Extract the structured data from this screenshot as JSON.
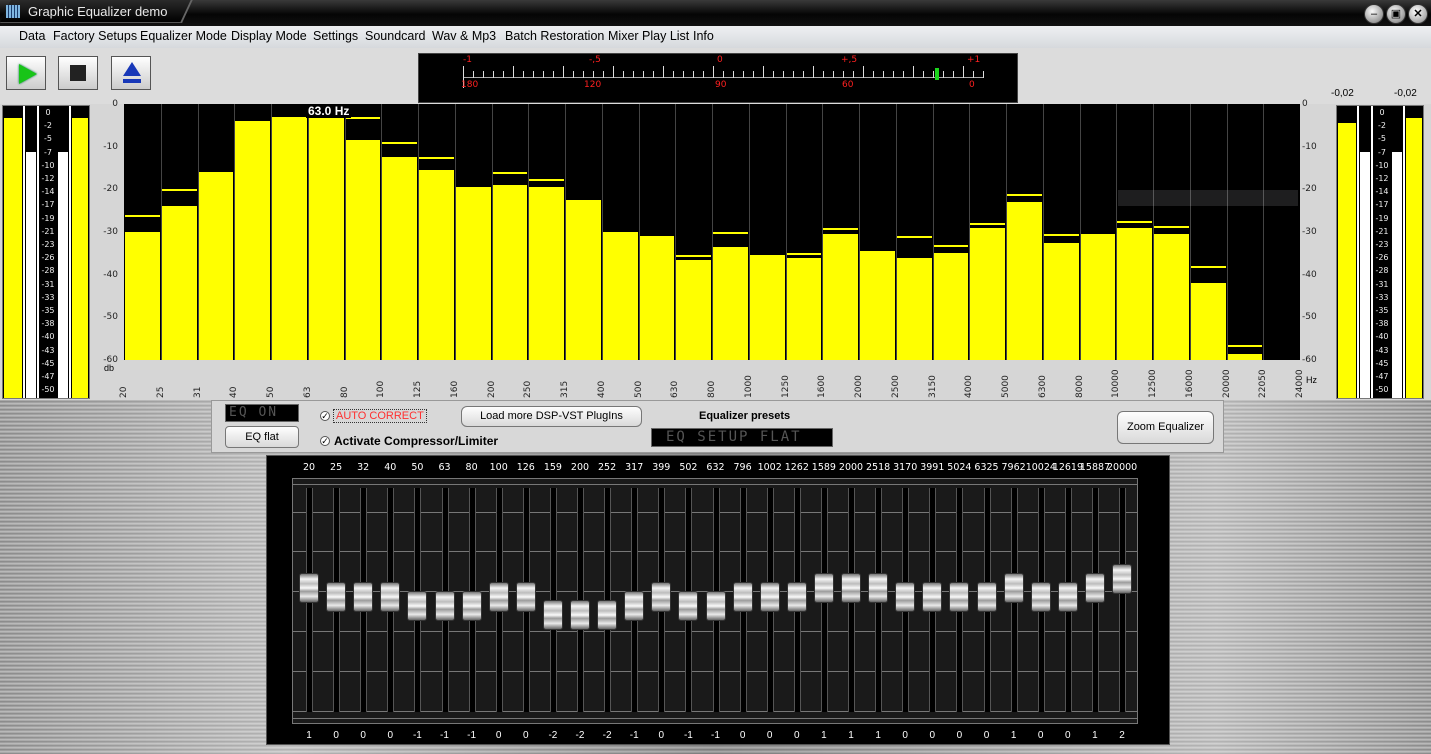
{
  "window": {
    "title": "Graphic Equalizer demo"
  },
  "menu": [
    "Data",
    "Factory Setups",
    "Equalizer Mode",
    "Display Mode",
    "Settings",
    "Soundcard",
    "Wav & Mp3",
    "Batch Restoration",
    "Mixer Play List",
    "Info"
  ],
  "phase_meter": {
    "top_labels": [
      "-1",
      "-,5",
      "0",
      "+,5",
      "+1"
    ],
    "bottom_labels": [
      "180",
      "120",
      "90",
      "60",
      "0"
    ],
    "level": 0.91
  },
  "vu_right_top_labels": [
    "-0,02",
    "-0,02"
  ],
  "vu_scale": [
    "0",
    "-2",
    "-5",
    "-7",
    "-10",
    "-12",
    "-14",
    "-17",
    "-19",
    "-21",
    "-23",
    "-26",
    "-28",
    "-31",
    "-33",
    "-35",
    "-38",
    "-40",
    "-43",
    "-45",
    "-47",
    "-50"
  ],
  "vu_levels": {
    "left_a": 0.98,
    "left_b": 0.86,
    "left_c": 0.86,
    "left_d": 0.98,
    "right_a": 0.96,
    "right_b": 0.86,
    "right_c": 0.86,
    "right_d": 0.98
  },
  "spectrum": {
    "cursor_label": "63.0 Hz",
    "db_unit": "db",
    "hz_unit": "Hz",
    "db_ticks": [
      "0",
      "-10",
      "-20",
      "-30",
      "-40",
      "-50",
      "-60"
    ],
    "hz_labels": [
      "20",
      "25",
      "31",
      "40",
      "50",
      "63",
      "80",
      "100",
      "125",
      "160",
      "200",
      "250",
      "315",
      "400",
      "500",
      "630",
      "800",
      "1000",
      "1250",
      "1600",
      "2000",
      "2500",
      "3150",
      "4000",
      "5000",
      "6300",
      "8000",
      "10000",
      "12500",
      "16000",
      "20000",
      "22050",
      "24000"
    ],
    "levels_db": [
      -30,
      -24,
      -16,
      -4.5,
      -3,
      -2.5,
      -8.5,
      -12.5,
      -15.5,
      -20,
      -19,
      -19.5,
      -23,
      -30.5,
      -31.5,
      -36.5,
      -33.5,
      -35.5,
      -36,
      -30.5,
      -35,
      -36,
      -35,
      -29,
      -23,
      -32.5,
      -30.5,
      -29,
      -30.5,
      -42,
      -58.5
    ],
    "peaks_db": [
      -26,
      -20,
      -16,
      -4,
      -3,
      -2.5,
      -3,
      -9,
      -12.5,
      -19.5,
      -16,
      -17.5,
      -22.5,
      -30,
      -31,
      -35.5,
      -30,
      -35.5,
      -35,
      -29,
      -34.5,
      -31,
      -33,
      -28,
      -21,
      -30.5,
      -30.5,
      -27.5,
      -28.5,
      -38,
      -56.5
    ]
  },
  "controls": {
    "lcd_eq": "EQ ON",
    "eq_flat_button": "EQ flat",
    "auto_correct": "AUTO CORRECT",
    "compressor": "Activate Compressor/Limiter",
    "load_plugins": "Load more DSP-VST PlugIns",
    "presets_label": "Equalizer presets",
    "preset_lcd": "EQ SETUP FLAT",
    "zoom_button": "Zoom Equalizer"
  },
  "eq": {
    "freqs": [
      "20",
      "25",
      "32",
      "40",
      "50",
      "63",
      "80",
      "100",
      "126",
      "159",
      "200",
      "252",
      "317",
      "399",
      "502",
      "632",
      "796",
      "1002",
      "1262",
      "1589",
      "2000",
      "2518",
      "3170",
      "3991",
      "5024",
      "6325",
      "7962",
      "10024",
      "12619",
      "15887",
      "20000"
    ],
    "gains": [
      1,
      0,
      0,
      0,
      -1,
      -1,
      -1,
      0,
      0,
      -2,
      -2,
      -2,
      -1,
      0,
      -1,
      -1,
      0,
      0,
      0,
      1,
      1,
      1,
      0,
      0,
      0,
      0,
      1,
      0,
      0,
      1,
      2
    ],
    "gain_labels": [
      "1",
      "0",
      "0",
      "0",
      "-1",
      "-1",
      "-1",
      "0",
      "0",
      "-2",
      "-2",
      "-2",
      "-1",
      "0",
      "-1",
      "-1",
      "0",
      "0",
      "0",
      "1",
      "1",
      "1",
      "0",
      "0",
      "0",
      "0",
      "1",
      "0",
      "0",
      "1",
      "2"
    ]
  }
}
